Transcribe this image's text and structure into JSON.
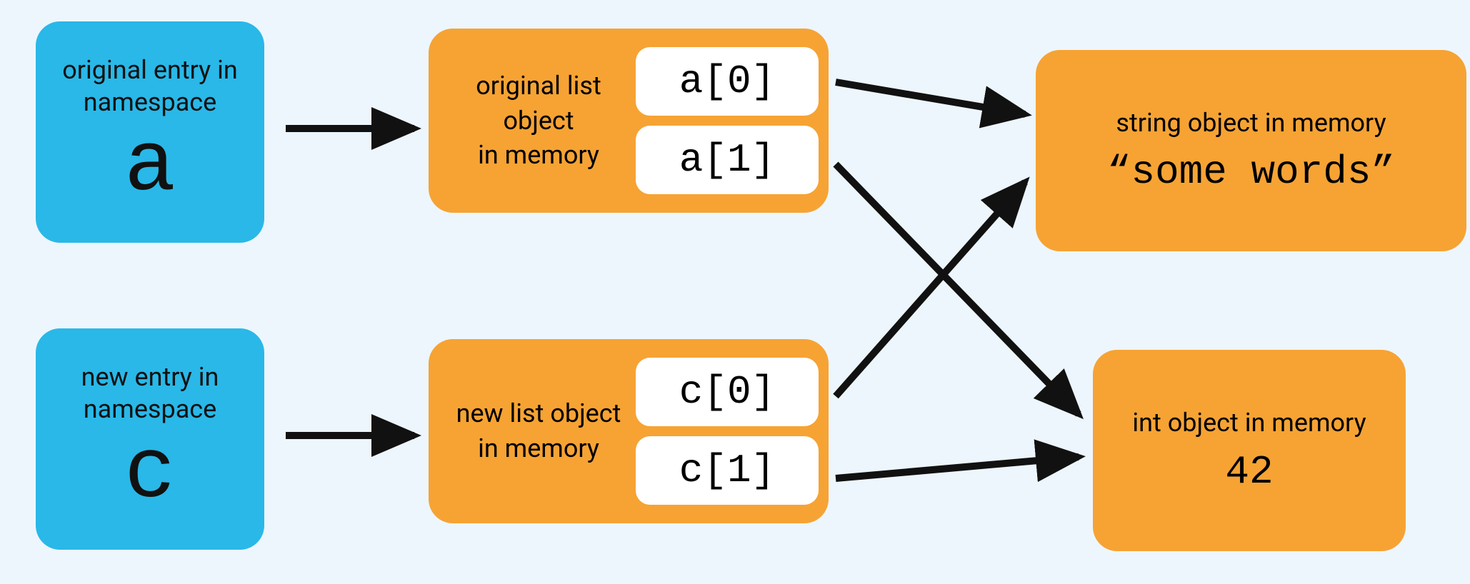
{
  "namespace": {
    "a": {
      "label": "original entry in namespace",
      "var": "a"
    },
    "c": {
      "label": "new entry in namespace",
      "var": "c"
    }
  },
  "lists": {
    "a": {
      "label": "original list object\nin memory",
      "cells": [
        "a[0]",
        "a[1]"
      ]
    },
    "c": {
      "label": "new list object\nin memory",
      "cells": [
        "c[0]",
        "c[1]"
      ]
    }
  },
  "values": {
    "str": {
      "label": "string object in memory",
      "value": "“some words”"
    },
    "int": {
      "label": "int object in memory",
      "value": "42"
    }
  },
  "pointers": [
    {
      "from": "namespace.a",
      "to": "lists.a"
    },
    {
      "from": "namespace.c",
      "to": "lists.c"
    },
    {
      "from": "lists.a.cells.0",
      "to": "values.str"
    },
    {
      "from": "lists.a.cells.1",
      "to": "values.int"
    },
    {
      "from": "lists.c.cells.0",
      "to": "values.str"
    },
    {
      "from": "lists.c.cells.1",
      "to": "values.int"
    }
  ],
  "colors": {
    "namespace_bg": "#29b8e8",
    "object_bg": "#f6a334",
    "canvas_bg": "#edf6fd",
    "cell_bg": "#ffffff",
    "arrow": "#111111"
  }
}
